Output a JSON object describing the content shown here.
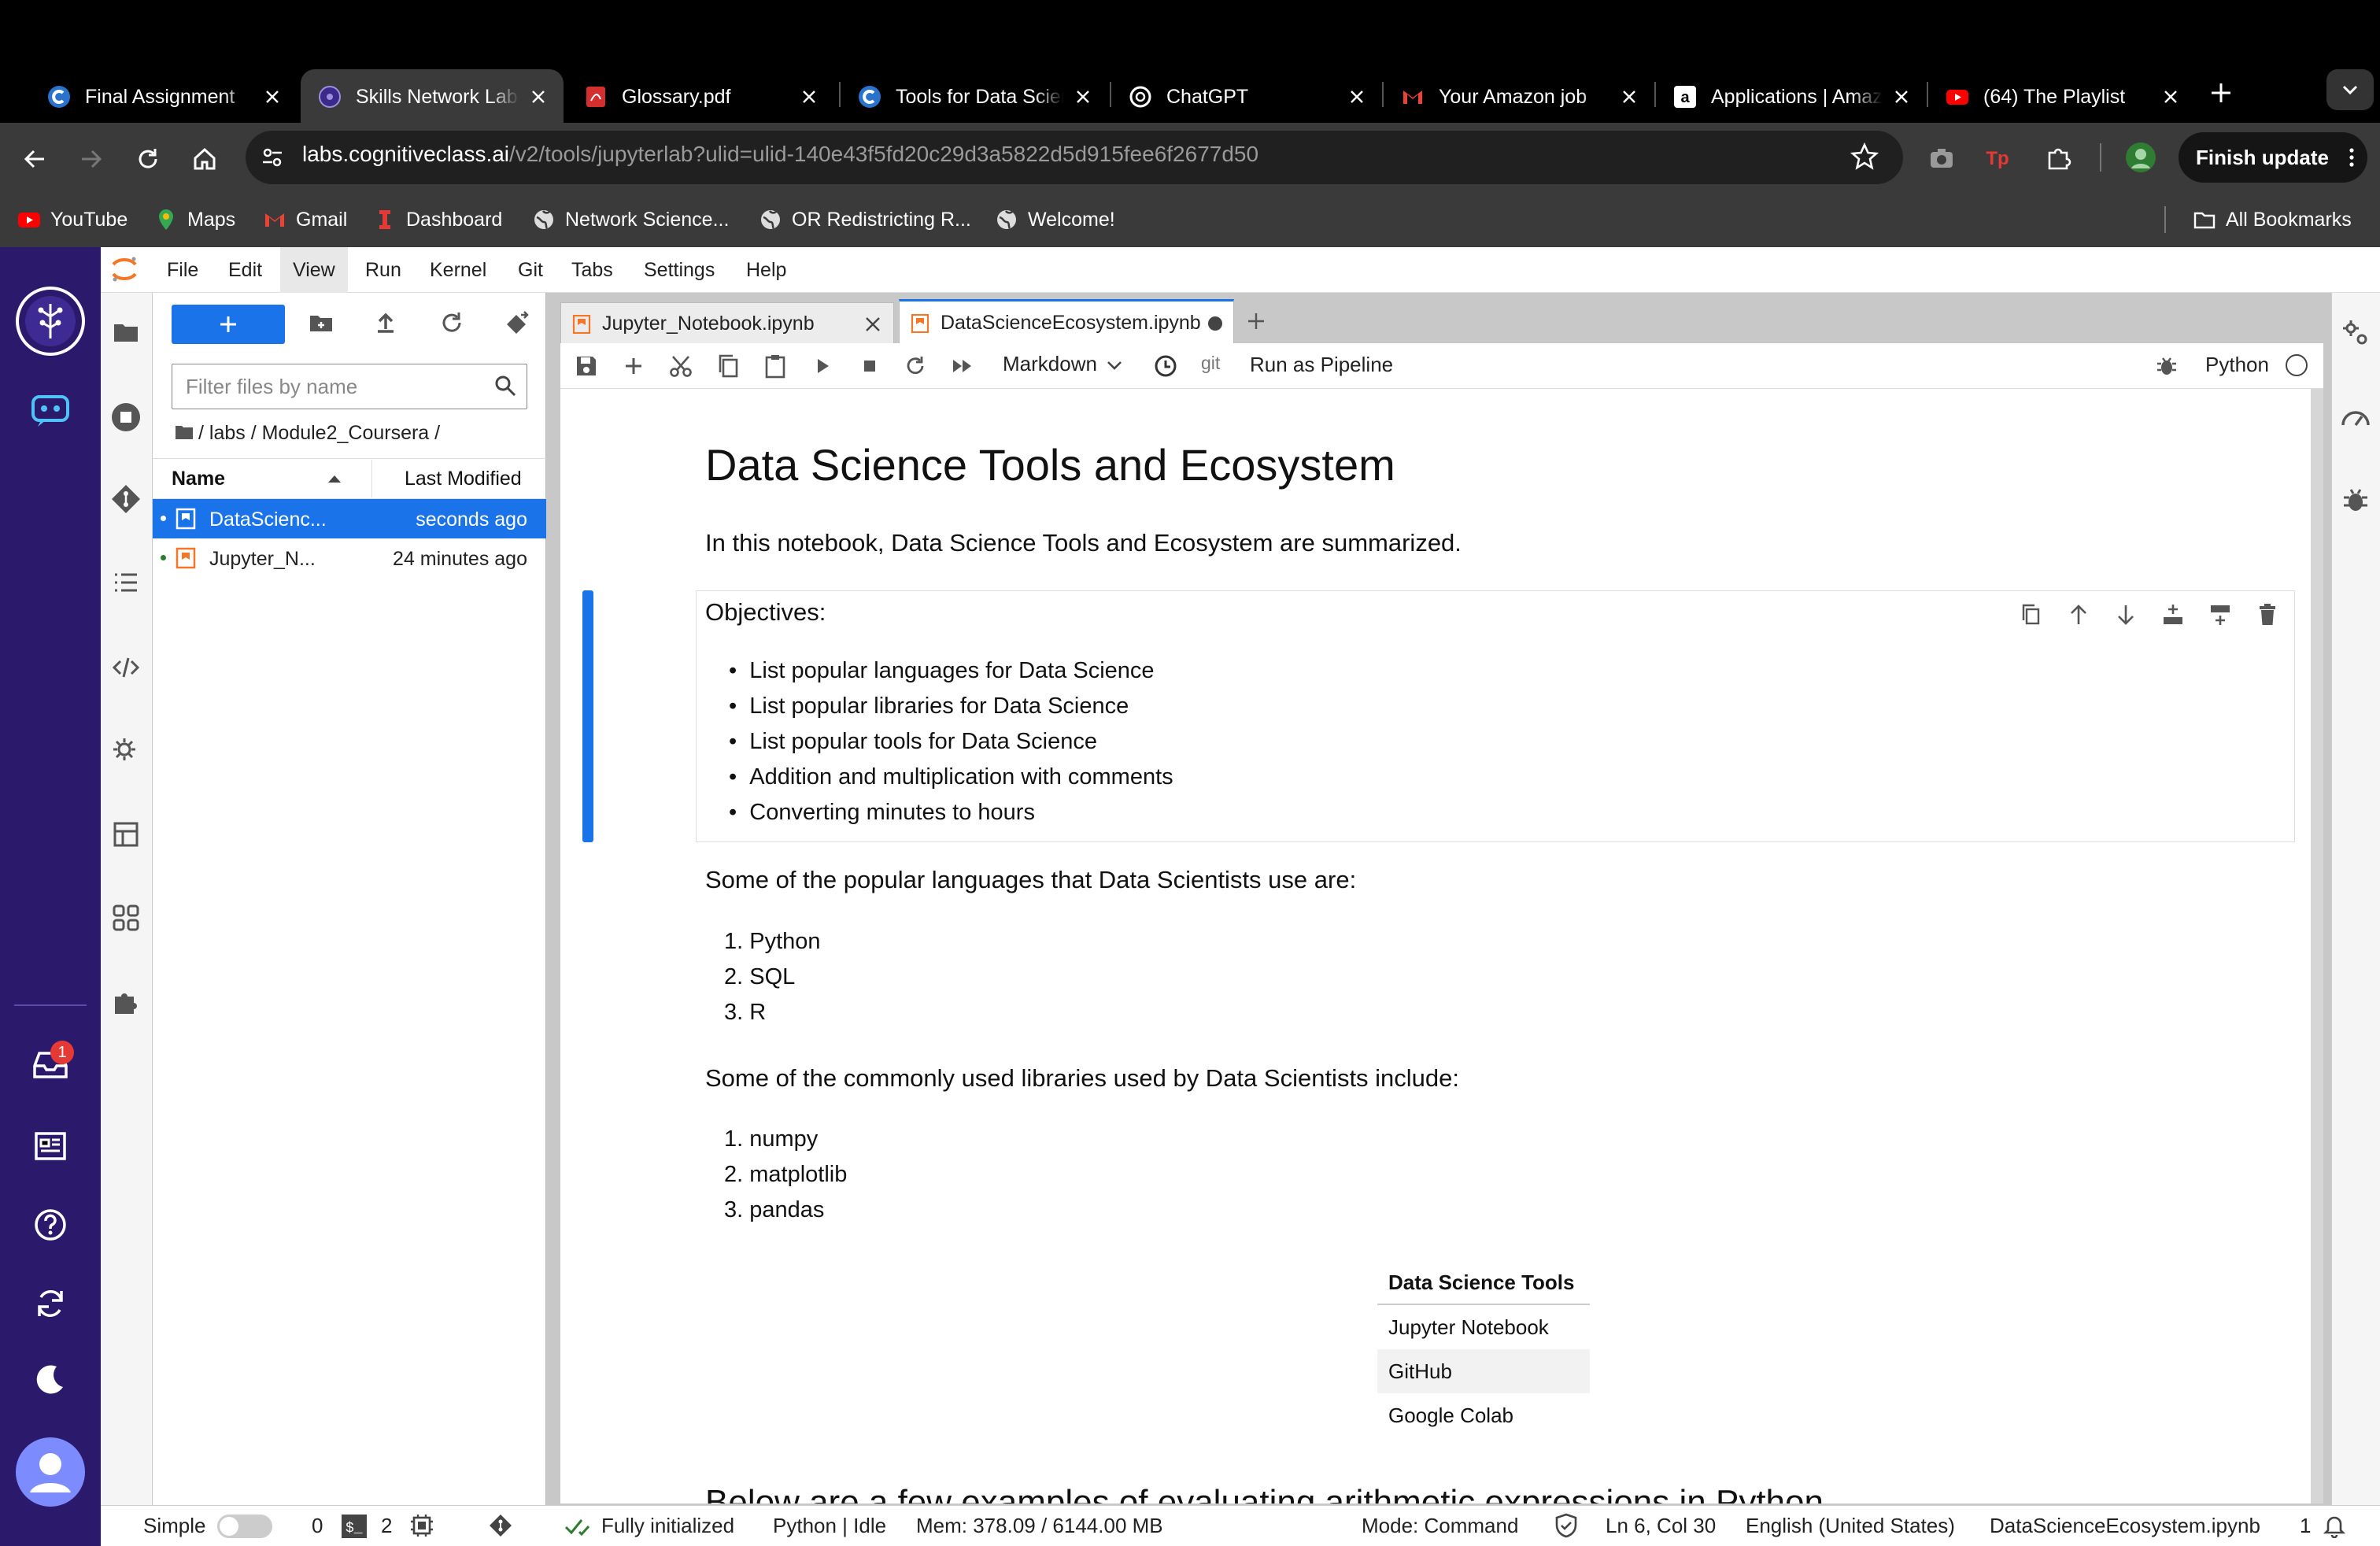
{
  "browser": {
    "tabs": [
      {
        "label": "Final Assignment",
        "icon": "coursera-icon"
      },
      {
        "label": "Skills Network Labs",
        "icon": "skills-network-icon",
        "active": true
      },
      {
        "label": "Glossary.pdf",
        "icon": "pdf-icon"
      },
      {
        "label": "Tools for Data Science",
        "icon": "coursera-icon"
      },
      {
        "label": "ChatGPT",
        "icon": "chatgpt-icon"
      },
      {
        "label": "Your Amazon job",
        "icon": "gmail-icon"
      },
      {
        "label": "Applications | Amazon",
        "icon": "amazon-icon"
      },
      {
        "label": "(64) The Playlist",
        "icon": "youtube-icon"
      }
    ],
    "url_host": "labs.cognitiveclass.ai",
    "url_path": "/v2/tools/jupyterlab?ulid=ulid-140e43f5fd20c29d3a5822d5d915fee6f2677d50",
    "finish_update": "Finish update",
    "bookmarks": [
      {
        "label": "YouTube",
        "icon": "youtube-icon"
      },
      {
        "label": "Maps",
        "icon": "maps-icon"
      },
      {
        "label": "Gmail",
        "icon": "gmail-icon"
      },
      {
        "label": "Dashboard",
        "icon": "dashboard-icon"
      },
      {
        "label": "Network Science...",
        "icon": "globe-icon"
      },
      {
        "label": "OR Redistricting R...",
        "icon": "globe-icon"
      },
      {
        "label": "Welcome!",
        "icon": "globe-icon"
      }
    ],
    "all_bookmarks": "All Bookmarks"
  },
  "jupyter": {
    "menu": [
      "File",
      "Edit",
      "View",
      "Run",
      "Kernel",
      "Git",
      "Tabs",
      "Settings",
      "Help"
    ],
    "notification_count": "1",
    "filebrowser": {
      "filter_placeholder": "Filter files by name",
      "breadcrumb": "/ labs / Module2_Coursera /",
      "col_name": "Name",
      "col_modified": "Last Modified",
      "files": [
        {
          "name": "DataScienc...",
          "modified": "seconds ago",
          "selected": true
        },
        {
          "name": "Jupyter_N...",
          "modified": "24 minutes ago",
          "selected": false
        }
      ]
    },
    "notebook_tabs": [
      {
        "label": "Jupyter_Notebook.ipynb",
        "active": false
      },
      {
        "label": "DataScienceEcosystem.ipynb",
        "active": true
      }
    ],
    "toolbar": {
      "cell_type": "Markdown",
      "git": "git",
      "run_pipeline": "Run as Pipeline",
      "kernel": "Python"
    },
    "notebook": {
      "title": "Data Science Tools and Ecosystem",
      "intro": "In this notebook, Data Science Tools and Ecosystem are summarized.",
      "objectives_heading": "Objectives:",
      "objectives": [
        "List popular languages for Data Science",
        "List popular libraries for Data Science",
        "List popular tools for Data Science",
        "Addition and multiplication with comments",
        "Converting minutes to hours"
      ],
      "languages_intro": "Some of the popular languages that Data Scientists use are:",
      "languages": [
        "Python",
        "SQL",
        "R"
      ],
      "libraries_intro": "Some of the commonly used libraries used by Data Scientists include:",
      "libraries": [
        "numpy",
        "matplotlib",
        "pandas"
      ],
      "tools_header": "Data Science Tools",
      "tools": [
        "Jupyter Notebook",
        "GitHub",
        "Google Colab"
      ],
      "next_heading": "Below are a few examples of evaluating arithmetic expressions in Python"
    },
    "status": {
      "mode_simple": "Simple",
      "terminals": "0",
      "kernels": "2",
      "init": "Fully initialized",
      "kernel_state": "Python | Idle",
      "mem": "Mem: 378.09 / 6144.00 MB",
      "mode": "Mode: Command",
      "position": "Ln 6, Col 30",
      "language": "English (United States)",
      "filename": "DataScienceEcosystem.ipynb",
      "notif": "1"
    }
  }
}
